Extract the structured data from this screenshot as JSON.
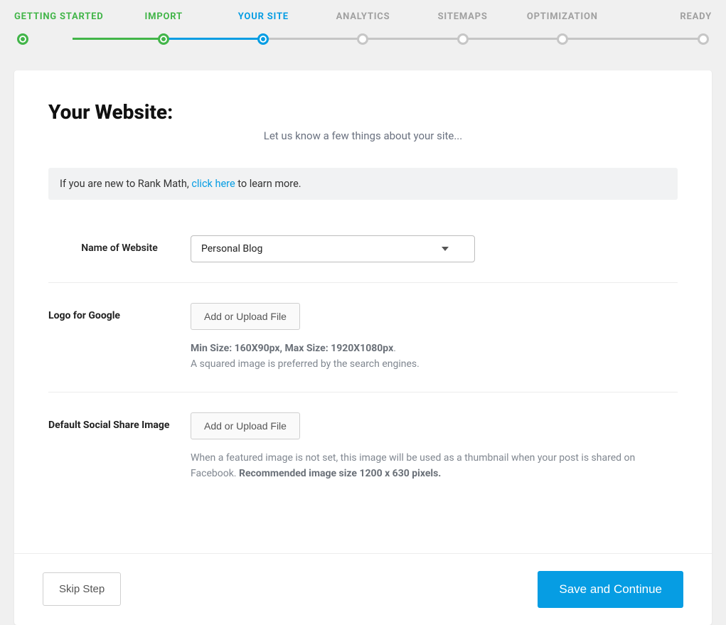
{
  "stepper": {
    "steps": [
      {
        "label": "GETTING STARTED",
        "state": "completed"
      },
      {
        "label": "IMPORT",
        "state": "completed"
      },
      {
        "label": "YOUR SITE",
        "state": "active"
      },
      {
        "label": "ANALYTICS",
        "state": "pending"
      },
      {
        "label": "SITEMAPS",
        "state": "pending"
      },
      {
        "label": "OPTIMIZATION",
        "state": "pending"
      },
      {
        "label": "READY",
        "state": "pending"
      }
    ]
  },
  "page": {
    "title": "Your Website:",
    "subtitle": "Let us know a few things about your site..."
  },
  "notice": {
    "prefix": "If you are new to Rank Math, ",
    "link_text": "click here",
    "suffix": " to learn more."
  },
  "fields": {
    "website_name": {
      "label": "Name of Website",
      "value": "Personal Blog"
    },
    "logo": {
      "label": "Logo for Google",
      "button": "Add or Upload File",
      "hint_strong": "Min Size: 160X90px, Max Size: 1920X1080px",
      "hint_rest": ".",
      "hint_line2": "A squared image is preferred by the search engines."
    },
    "social_image": {
      "label": "Default Social Share Image",
      "button": "Add or Upload File",
      "hint_prefix": "When a featured image is not set, this image will be used as a thumbnail when your post is shared on Facebook. ",
      "hint_strong": "Recommended image size 1200 x 630 pixels."
    }
  },
  "footer": {
    "skip": "Skip Step",
    "save": "Save and Continue"
  }
}
